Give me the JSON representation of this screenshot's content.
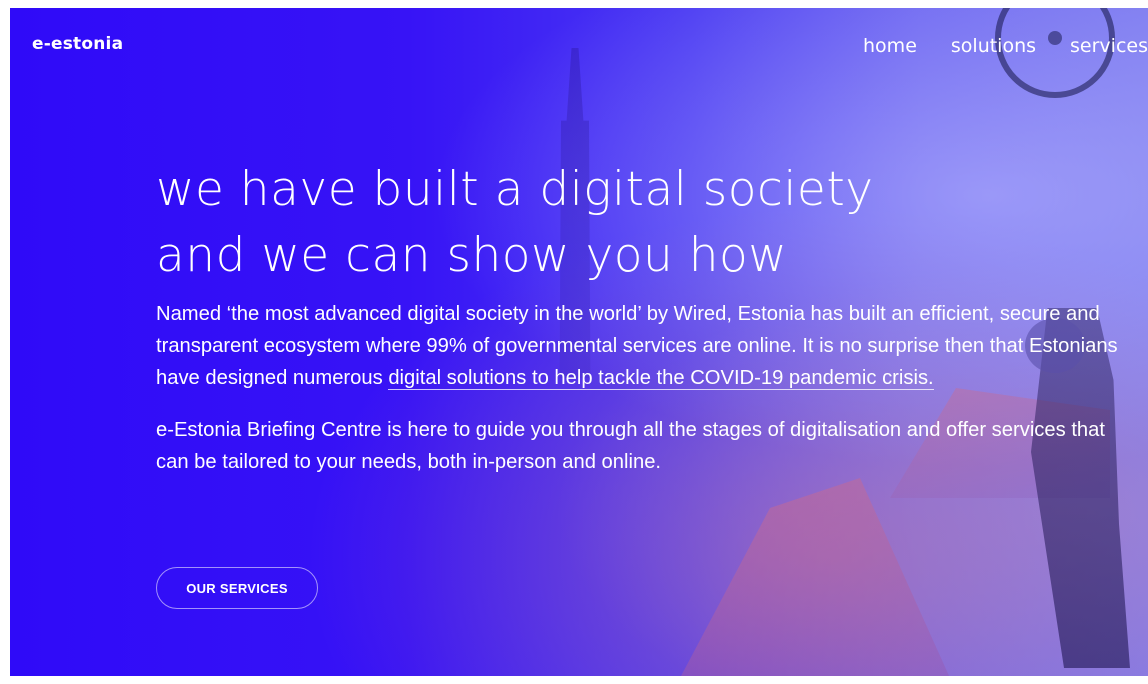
{
  "header": {
    "logo": "e-estonia",
    "nav": [
      {
        "label": "home"
      },
      {
        "label": "solutions"
      },
      {
        "label": "services"
      }
    ]
  },
  "hero": {
    "headline_line1": "we have built a digital society",
    "headline_line2": "and we can show you how",
    "paragraph1_text": "Named ‘the most advanced digital society in the world’ by Wired, Estonia has built an efficient, secure and transparent ecosystem where 99% of governmental services are online. It is no surprise then that Estonians have designed numerous ",
    "paragraph1_link": "digital solutions to help tackle the COVID-19 pandemic crisis.",
    "paragraph2": "e-Estonia Briefing Centre is here to guide you through all the stages of digitalisation and offer services that can be tailored to your needs, both in-person and online.",
    "cta_label": "OUR SERVICES"
  },
  "colors": {
    "brand_blue": "#3a10f5",
    "text": "#ffffff"
  }
}
